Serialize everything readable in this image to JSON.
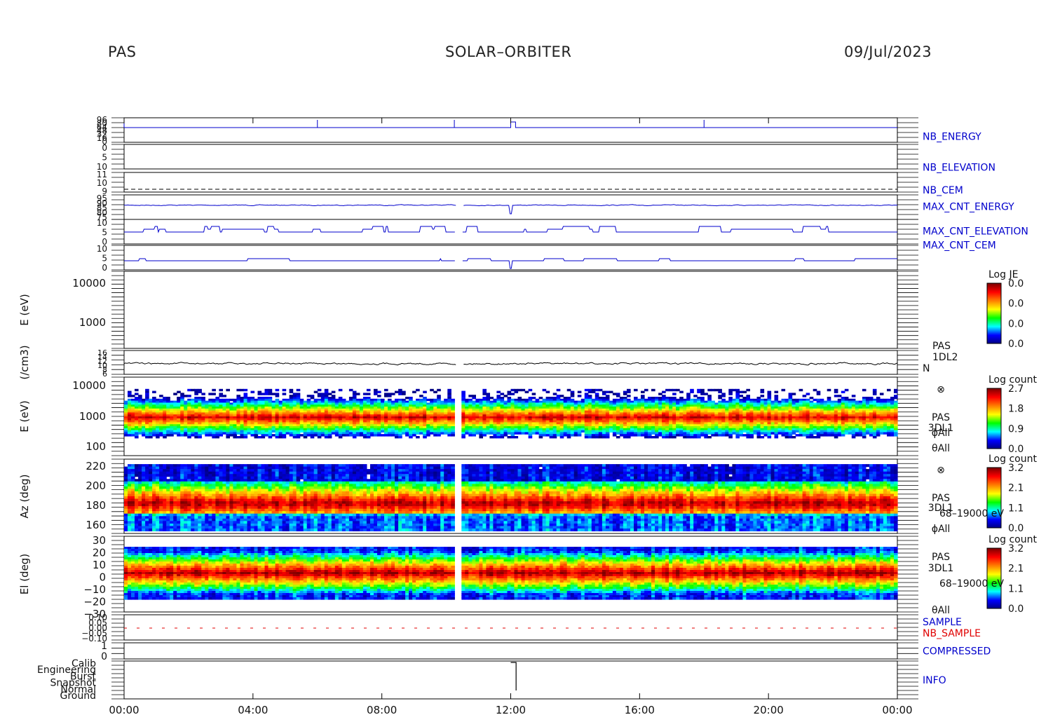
{
  "header": {
    "instrument": "PAS",
    "mission": "SOLAR–ORBITER",
    "date": "09/Jul/2023"
  },
  "colors": {
    "line_blue": "#0000cc",
    "line_black": "#000000",
    "label_red": "#e00000",
    "colormap": [
      "#00007f",
      "#0000ff",
      "#00ffff",
      "#00ff00",
      "#ffff00",
      "#ff7f00",
      "#ff0000",
      "#7f0000"
    ]
  },
  "chart_data": [
    {
      "type": "line",
      "name_label": "NB_ENERGY",
      "label_color": "#0000cc",
      "yticks": [
        "96",
        "80",
        "64",
        "48",
        "32",
        "16",
        "0"
      ],
      "events": [
        {
          "x": "00:00",
          "desc": "spike"
        },
        {
          "x": "06:00",
          "desc": "spike"
        },
        {
          "x": "10:15",
          "desc": "spike"
        },
        {
          "x": "12:00",
          "desc": "step"
        },
        {
          "x": "18:00",
          "desc": "spike"
        }
      ]
    },
    {
      "type": "line",
      "name_label": "NB_ELEVATION",
      "label_color": "#0000cc",
      "yticks": [
        "0",
        "5",
        "10"
      ]
    },
    {
      "type": "line",
      "name_label": "NB_CEM",
      "label_color": "#0000cc",
      "yticks": [
        "11",
        "10",
        "9"
      ]
    },
    {
      "type": "line",
      "name_label": "MAX_CNT_ENERGY",
      "label_color": "#0000cc",
      "yticks": [
        "95",
        "90",
        "85",
        "80",
        "75"
      ]
    },
    {
      "type": "line",
      "name_label": "MAX_CNT_ELEVATION",
      "label_color": "#0000cc",
      "yticks": [
        "10",
        "5",
        "0"
      ]
    },
    {
      "type": "line",
      "name_label": "MAX_CNT_CEM",
      "label_color": "#0000cc",
      "yticks": [
        "10",
        "5",
        "0"
      ]
    },
    {
      "type": "heatmap",
      "ylabel": "E (eV)",
      "yticks": [
        "10000",
        "1000"
      ],
      "colorbar": {
        "title": "Log JE",
        "ticks": [
          "0.0",
          "0.0",
          "0.0",
          "0.0"
        ]
      },
      "note": "empty panel"
    },
    {
      "type": "line",
      "ylabel": "(/cm3)",
      "right_labels": [
        "PAS",
        "1DL2",
        "N"
      ],
      "yticks": [
        "16",
        "14",
        "12",
        "10",
        "8",
        "6"
      ],
      "typical_value": 10
    },
    {
      "type": "heatmap",
      "ylabel": "E (eV)",
      "yticks": [
        "10000",
        "1000",
        "100"
      ],
      "right_labels": [
        "⊗",
        "PAS",
        "3DL1",
        "ϕAll",
        "θAll"
      ],
      "colorbar": {
        "title": "Log count",
        "ticks": [
          "2.7",
          "1.8",
          "0.9",
          "0.0"
        ],
        "range": [
          0.0,
          2.7
        ]
      },
      "peak_energy_eV": 800,
      "gap": [
        "10:15",
        "10:30"
      ]
    },
    {
      "type": "heatmap",
      "ylabel": "Az (deg)",
      "yticks": [
        "220",
        "200",
        "180",
        "160"
      ],
      "right_labels": [
        "⊗",
        "PAS",
        "3DL1",
        "68–19000 eV",
        "ϕAll"
      ],
      "colorbar": {
        "title": "Log count",
        "ticks": [
          "3.2",
          "2.1",
          "1.1",
          "0.0"
        ],
        "range": [
          0.0,
          3.2
        ]
      },
      "peak_az_deg": 182,
      "gap": [
        "10:15",
        "10:30"
      ]
    },
    {
      "type": "heatmap",
      "ylabel": "El (deg)",
      "yticks": [
        "30",
        "20",
        "10",
        "0",
        "−10",
        "−20",
        "−30"
      ],
      "right_labels": [
        "PAS",
        "3DL1",
        "68–19000 eV",
        "θAll"
      ],
      "colorbar": {
        "title": "Log count",
        "ticks": [
          "3.2",
          "2.1",
          "1.1",
          "0.0"
        ],
        "range": [
          0.0,
          3.2
        ]
      },
      "peak_el_deg": 3,
      "gap": [
        "10:15",
        "10:30"
      ]
    },
    {
      "type": "line",
      "yticks": [
        "0.10",
        "0.05",
        "0.00",
        "−0.05",
        "−0.10"
      ],
      "series": [
        {
          "name": "SAMPLE",
          "color": "#0000cc"
        },
        {
          "name": "NB_SAMPLE",
          "color": "#e00000"
        }
      ]
    },
    {
      "type": "line",
      "name_label": "COMPRESSED",
      "label_color": "#0000cc",
      "yticks": [
        "1",
        "0"
      ]
    },
    {
      "type": "line",
      "name_label": "INFO",
      "label_color": "#0000cc",
      "yticks": [
        "Calib",
        "Engineering",
        "Burst",
        "Snapshot",
        "Normal",
        "Ground"
      ],
      "events": [
        {
          "x": "12:00",
          "state": "Calib",
          "until": "12:10"
        }
      ]
    }
  ],
  "x_axis": {
    "ticks": [
      "00:00",
      "04:00",
      "08:00",
      "12:00",
      "16:00",
      "20:00",
      "00:00"
    ],
    "range": [
      "00:00",
      "24:00"
    ]
  }
}
